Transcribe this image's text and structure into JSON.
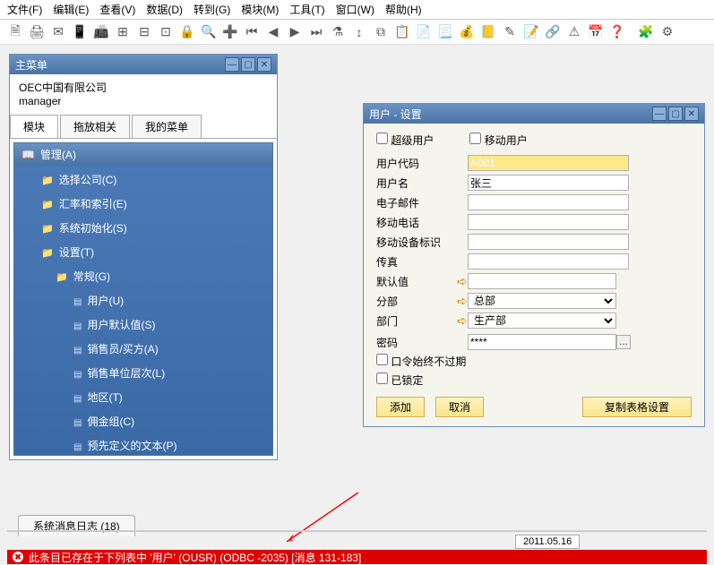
{
  "menu": [
    "文件(F)",
    "编辑(E)",
    "查看(V)",
    "数据(D)",
    "转到(G)",
    "模块(M)",
    "工具(T)",
    "窗口(W)",
    "帮助(H)"
  ],
  "main_menu": {
    "title": "主菜单",
    "company": "OEC中国有限公司",
    "role": "manager",
    "tabs": [
      "模块",
      "拖放相关",
      "我的菜单"
    ],
    "tree_header": "管理(A)",
    "items": [
      {
        "lvl": 1,
        "icon": "folder",
        "label": "选择公司(C)"
      },
      {
        "lvl": 1,
        "icon": "folder",
        "label": "汇率和索引(E)"
      },
      {
        "lvl": 1,
        "icon": "folder",
        "label": "系统初始化(S)"
      },
      {
        "lvl": 1,
        "icon": "folder",
        "label": "设置(T)"
      },
      {
        "lvl": 2,
        "icon": "folder",
        "label": "常规(G)"
      },
      {
        "lvl": 3,
        "icon": "file",
        "label": "用户(U)"
      },
      {
        "lvl": 3,
        "icon": "file",
        "label": "用户默认值(S)"
      },
      {
        "lvl": 3,
        "icon": "file",
        "label": "销售员/买方(A)"
      },
      {
        "lvl": 3,
        "icon": "file",
        "label": "销售单位层次(L)"
      },
      {
        "lvl": 3,
        "icon": "file",
        "label": "地区(T)"
      },
      {
        "lvl": 3,
        "icon": "file",
        "label": "佣金组(C)"
      },
      {
        "lvl": 3,
        "icon": "file",
        "label": "预先定义的文本(P)"
      }
    ]
  },
  "user_window": {
    "title": "用户 - 设置",
    "checks": {
      "super": "超级用户",
      "mobile": "移动用户"
    },
    "labels": {
      "code": "用户代码",
      "name": "用户名",
      "email": "电子邮件",
      "phone": "移动电话",
      "device": "移动设备标识",
      "fax": "传真",
      "defaults": "默认值",
      "branch": "分部",
      "dept": "部门",
      "password": "密码",
      "noexpire": "口令始终不过期",
      "locked": "已锁定"
    },
    "values": {
      "code": "A001",
      "name": "张三",
      "email": "",
      "phone": "",
      "device": "",
      "fax": "",
      "defaults": "",
      "branch": "总部",
      "dept": "生产部",
      "password": "****"
    },
    "buttons": {
      "add": "添加",
      "cancel": "取消",
      "copy": "复制表格设置"
    }
  },
  "log_tab": "系统消息日志 (18)",
  "date": "2011.05.16",
  "error": "此条目已存在于下列表中 '用户' (OUSR) (ODBC -2035)  [消息 131-183]"
}
